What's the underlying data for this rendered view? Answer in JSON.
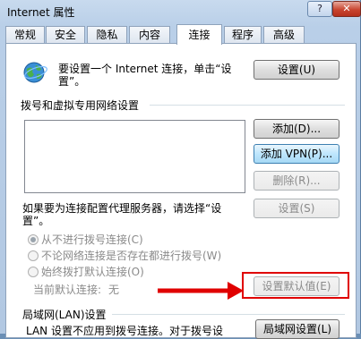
{
  "window": {
    "title": "Internet 属性",
    "help_label": "?",
    "close_label": "✕"
  },
  "tabs": [
    {
      "label": "常规"
    },
    {
      "label": "安全"
    },
    {
      "label": "隐私"
    },
    {
      "label": "内容"
    },
    {
      "label": "连接"
    },
    {
      "label": "程序"
    },
    {
      "label": "高级"
    }
  ],
  "active_tab": "连接",
  "setup": {
    "text_line1": "要设置一个 Internet 连接，单击“设",
    "text_line2": "置”。",
    "button": "设置(U)"
  },
  "dialup": {
    "heading": "拨号和虚拟专用网络设置",
    "add_button": "添加(D)...",
    "add_vpn_button": "添加 VPN(P)...",
    "remove_button": "删除(R)...",
    "proxy_text_line1": "如果要为连接配置代理服务器，请选择“设",
    "proxy_text_line2": "置”。",
    "settings_button": "设置(S)",
    "options": [
      {
        "label": "从不进行拨号连接(C)",
        "checked": true
      },
      {
        "label": "不论网络连接是否存在都进行拨号(W)",
        "checked": false
      },
      {
        "label": "始终拨打默认连接(O)",
        "checked": false
      }
    ],
    "current_default_label": "当前默认连接:",
    "current_default_value": "无",
    "set_default_button": "设置默认值(E)"
  },
  "lan": {
    "heading": "局域网(LAN)设置",
    "text": "LAN 设置不应用到拨号连接。对于拨号设",
    "button": "局域网设置(L)"
  },
  "colors": {
    "annotation": "#e00000"
  }
}
